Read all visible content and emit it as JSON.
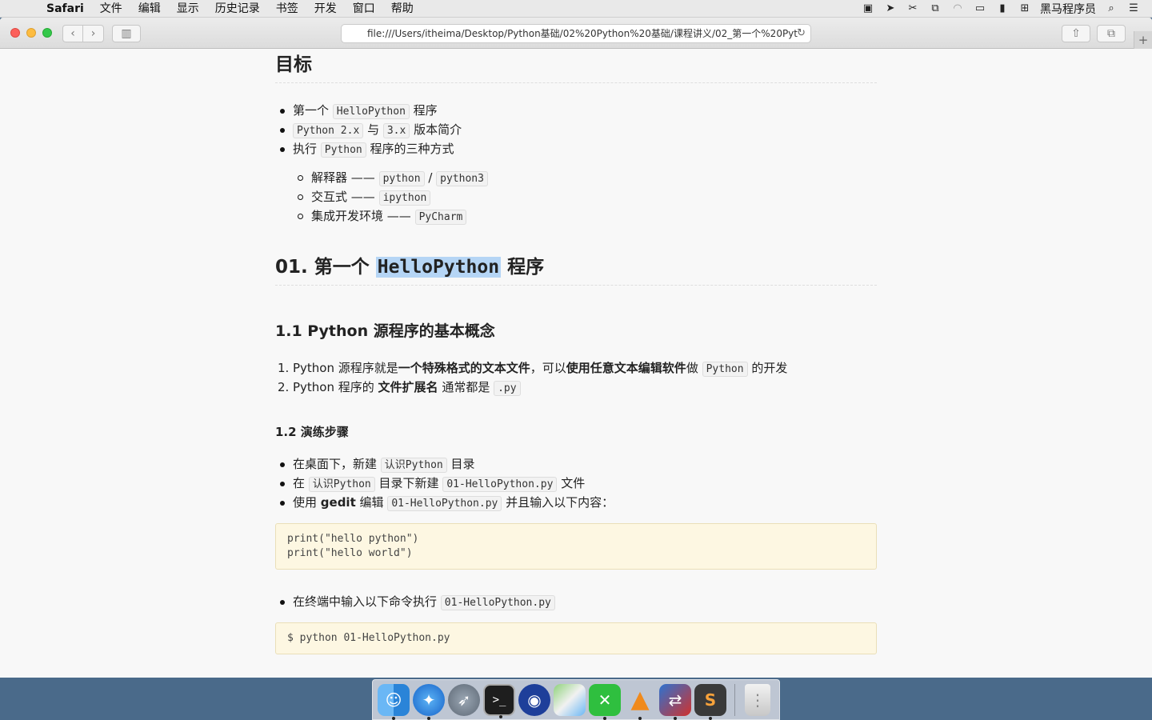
{
  "menubar": {
    "app_name": "Safari",
    "items": [
      "文件",
      "编辑",
      "显示",
      "历史记录",
      "书签",
      "开发",
      "窗口",
      "帮助"
    ],
    "user": "黑马程序员"
  },
  "toolbar": {
    "url": "file:///Users/itheima/Desktop/Python基础/02%20Python%20基础/课程讲义/02_第一个%20Pyt"
  },
  "doc": {
    "goal_title": "目标",
    "goal_items": [
      {
        "pre": "第一个",
        "code": "HelloPython",
        "post": "程序"
      },
      {
        "code1": "Python 2.x",
        "mid": "与",
        "code2": "3.x",
        "post": "版本简介"
      },
      {
        "pre": "执行",
        "code": "Python",
        "post": "程序的三种方式"
      }
    ],
    "goal_sub": [
      {
        "pre": "解释器 ——",
        "code1": "python",
        "mid": "/",
        "code2": "python3"
      },
      {
        "pre": "交互式 ——",
        "code": "ipython"
      },
      {
        "pre": "集成开发环境 ——",
        "code": "PyCharm"
      }
    ],
    "section1_prefix": "01. 第一个",
    "section1_code": "HelloPython",
    "section1_suffix": "程序",
    "sub11_title": "1.1 Python 源程序的基本概念",
    "sub11_items": [
      {
        "num": "1.",
        "t1": "Python 源程序就是",
        "b1": "一个特殊格式的文本文件",
        "t2": "，可以",
        "b2": "使用任意文本编辑软件",
        "t3": "做",
        "code": "Python",
        "t4": "的开发"
      },
      {
        "num": "2.",
        "t1": "Python 程序的 ",
        "b1": "文件扩展名",
        "t2": " 通常都是",
        "code": ".py"
      }
    ],
    "sub12_title": "1.2 演练步骤",
    "sub12_items": [
      {
        "pre": "在桌面下，新建",
        "code": "认识Python",
        "post": "目录"
      },
      {
        "pre": "在",
        "code1": "认识Python",
        "mid": "目录下新建",
        "code2": "01-HelloPython.py",
        "post": "文件"
      },
      {
        "pre": "使用 ",
        "bold": "gedit",
        "mid": " 编辑",
        "code": "01-HelloPython.py",
        "post": "并且输入以下内容："
      }
    ],
    "codeblock1": "print(\"hello python\")\nprint(\"hello world\")",
    "run_item": {
      "pre": "在终端中输入以下命令执行",
      "code": "01-HelloPython.py"
    },
    "codeblock2": "$ python 01-HelloPython.py"
  },
  "dock": {
    "apps": [
      "finder-icon",
      "safari-icon",
      "launchpad-icon",
      "terminal-icon",
      "screenrecord-icon",
      "maps-icon",
      "xmind-icon",
      "vlc-icon",
      "filezilla-icon",
      "sublime-icon",
      "trash-icon"
    ]
  }
}
